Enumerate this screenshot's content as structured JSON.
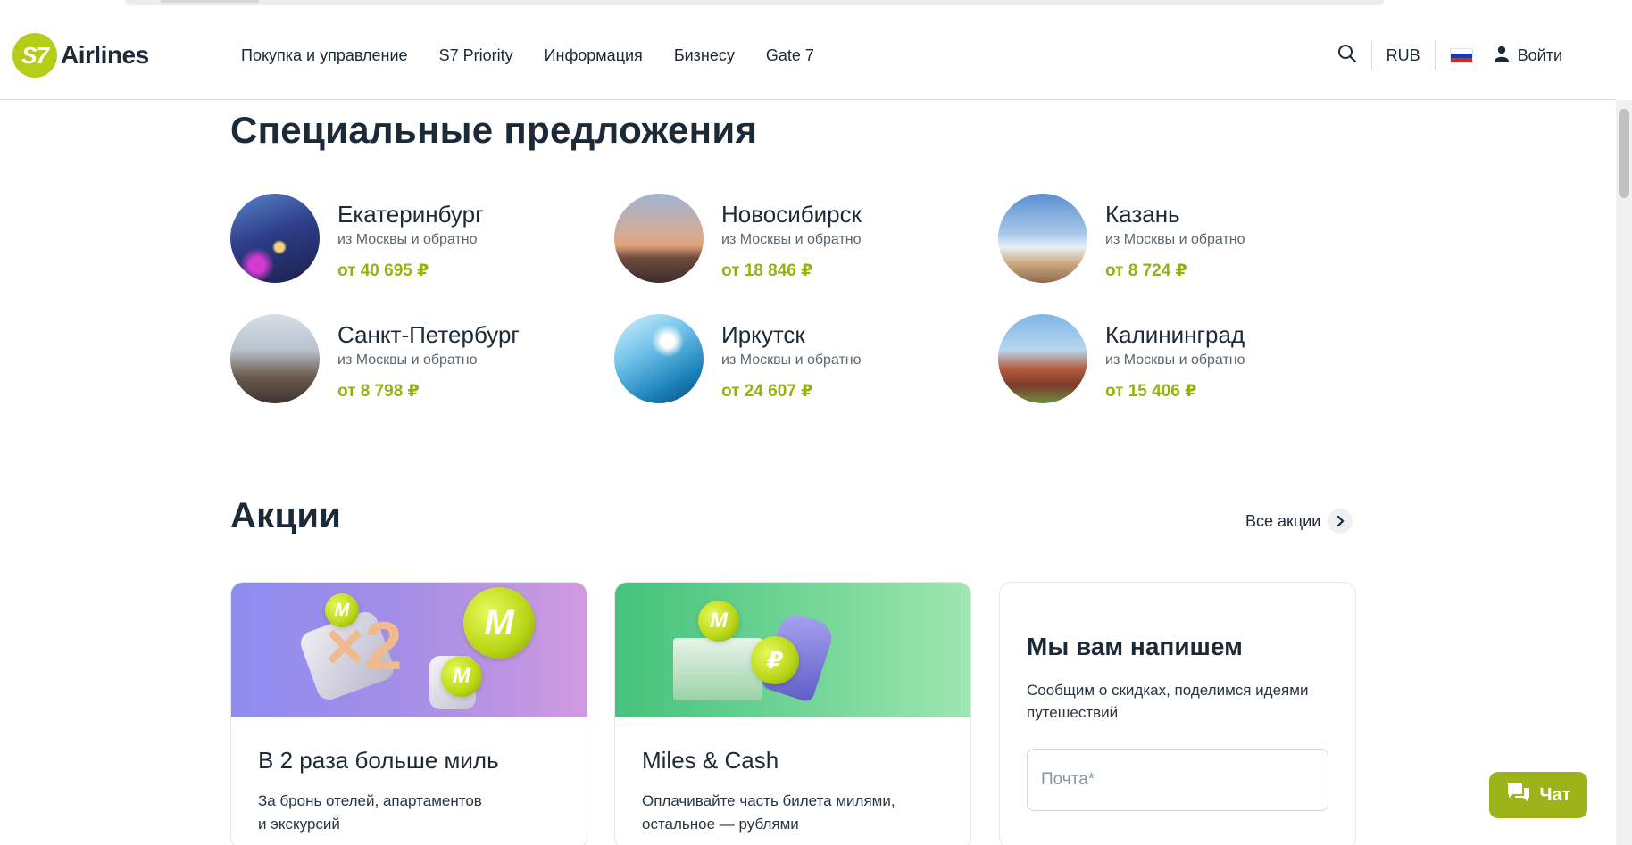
{
  "header": {
    "logo_mark": "S7",
    "logo_text": "Airlines",
    "nav": [
      "Покупка и управление",
      "S7 Priority",
      "Информация",
      "Бизнесу",
      "Gate 7"
    ],
    "currency": "RUB",
    "login_label": "Войти"
  },
  "offers": {
    "title": "Специальные предложения",
    "items": [
      {
        "city": "Екатеринбург",
        "sub": "из Москвы и обратно",
        "price": "от 40 695 ₽"
      },
      {
        "city": "Новосибирск",
        "sub": "из Москвы и обратно",
        "price": "от 18 846 ₽"
      },
      {
        "city": "Казань",
        "sub": "из Москвы и обратно",
        "price": "от 8 724 ₽"
      },
      {
        "city": "Санкт-Петербург",
        "sub": "из Москвы и обратно",
        "price": "от 8 798 ₽"
      },
      {
        "city": "Иркутск",
        "sub": "из Москвы и обратно",
        "price": "от 24 607 ₽"
      },
      {
        "city": "Калининград",
        "sub": "из Москвы и обратно",
        "price": "от 15 406 ₽"
      }
    ]
  },
  "promos": {
    "title": "Акции",
    "all_link": "Все акции",
    "cards": [
      {
        "title": "В 2 раза больше миль",
        "text_line1": "За бронь отелей, апартаментов",
        "text_line2": "и экскурсий",
        "coin_mark": "M",
        "multiplier": "×2"
      },
      {
        "title": "Miles & Cash",
        "text_line1": "Оплачивайте часть билета милями,",
        "text_line2": "остальное — рублями",
        "coin_mark": "M",
        "coin_mark_2": "₽"
      }
    ],
    "subscribe": {
      "title": "Мы вам напишем",
      "text": "Сообщим о скидках, поделимся идеями путешествий",
      "email_placeholder": "Почта*"
    }
  },
  "chat": {
    "label": "Чат"
  },
  "colors": {
    "brand_green": "#b5cc18",
    "price_green": "#98b013",
    "text_dark": "#1c2937"
  }
}
